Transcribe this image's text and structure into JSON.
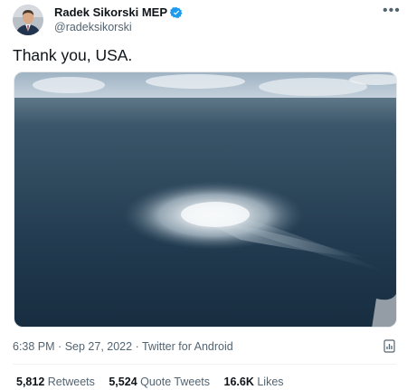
{
  "tweet": {
    "display_name": "Radek Sikorski MEP",
    "handle": "@radeksikorski",
    "text": "Thank you, USA.",
    "time": "6:38 PM",
    "date": "Sep 27, 2022",
    "source": "Twitter for Android",
    "separator": "·"
  },
  "stats": {
    "retweets_count": "5,812",
    "retweets_label": "Retweets",
    "quotes_count": "5,524",
    "quotes_label": "Quote Tweets",
    "likes_count": "16.6K",
    "likes_label": "Likes"
  },
  "colors": {
    "verified": "#1d9bf0",
    "text": "#0f1419",
    "secondary": "#536471"
  },
  "icons": {
    "more": "more-options-icon",
    "verified": "verified-badge-icon",
    "analytics": "analytics-icon"
  }
}
